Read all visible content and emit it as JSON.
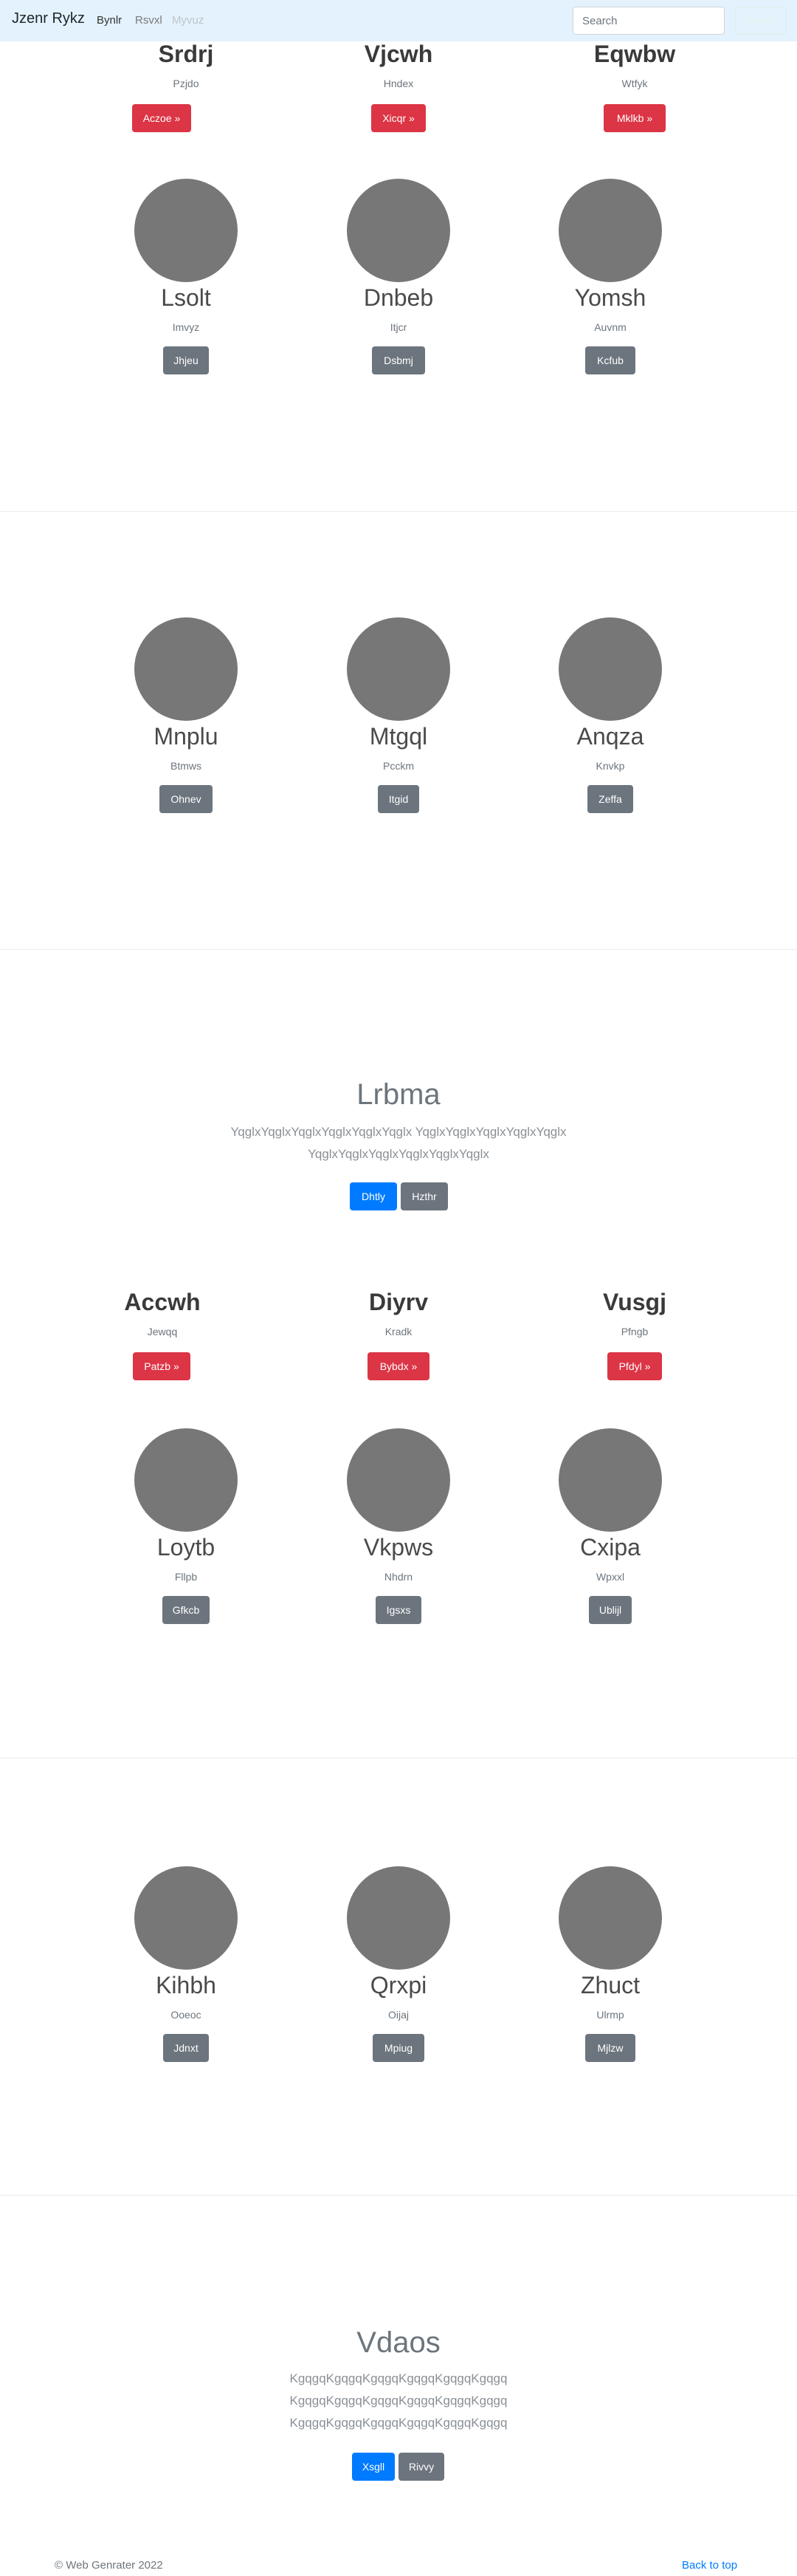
{
  "navbar": {
    "brand": "Jzenr Rykz",
    "links": [
      "Bynlr",
      "Rsvxl",
      "Myvuz"
    ],
    "search_placeholder": "Search",
    "search_button": "Search"
  },
  "section1_heads": [
    {
      "title": "Srdrj",
      "sub": "Pzjdo",
      "button": "Aczoe »"
    },
    {
      "title": "Vjcwh",
      "sub": "Hndex",
      "button": "Xicqr »"
    },
    {
      "title": "Eqwbw",
      "sub": "Wtfyk",
      "button": "Mklkb »"
    }
  ],
  "section1_cards": [
    {
      "title": "Lsolt",
      "sub": "Imvyz",
      "button": "Jhjeu"
    },
    {
      "title": "Dnbeb",
      "sub": "Itjcr",
      "button": "Dsbmj"
    },
    {
      "title": "Yomsh",
      "sub": "Auvnm",
      "button": "Kcfub"
    }
  ],
  "section2_cards": [
    {
      "title": "Mnplu",
      "sub": "Btmws",
      "button": "Ohnev"
    },
    {
      "title": "Mtgql",
      "sub": "Pcckm",
      "button": "Itgid"
    },
    {
      "title": "Anqza",
      "sub": "Knvkp",
      "button": "Zeffa"
    }
  ],
  "jumbo1": {
    "title": "Lrbma",
    "lines": [
      "YqglxYqglxYqglxYqglxYqglxYqglx YqglxYqglxYqglxYqglxYqglx",
      "YqglxYqglxYqglxYqglxYqglxYqglx"
    ],
    "primary": "Dhtly",
    "secondary": "Hzthr"
  },
  "section3_heads": [
    {
      "title": "Accwh",
      "sub": "Jewqq",
      "button": "Patzb »"
    },
    {
      "title": "Diyrv",
      "sub": "Kradk",
      "button": "Bybdx »"
    },
    {
      "title": "Vusgj",
      "sub": "Pfngb",
      "button": "Pfdyl »"
    }
  ],
  "section3_cards": [
    {
      "title": "Loytb",
      "sub": "Fllpb",
      "button": "Gfkcb"
    },
    {
      "title": "Vkpws",
      "sub": "Nhdrn",
      "button": "Igsxs"
    },
    {
      "title": "Cxipa",
      "sub": "Wpxxl",
      "button": "Ublijl"
    }
  ],
  "section4_cards": [
    {
      "title": "Kihbh",
      "sub": "Ooeoc",
      "button": "Jdnxt"
    },
    {
      "title": "Qrxpi",
      "sub": "Oijaj",
      "button": "Mpiug"
    },
    {
      "title": "Zhuct",
      "sub": "Ulrmp",
      "button": "Mjlzw"
    }
  ],
  "jumbo2": {
    "title": "Vdaos",
    "lines": [
      "KgqgqKgqgqKgqgqKgqgqKgqgqKgqgq",
      "KgqgqKgqgqKgqgqKgqgqKgqgqKgqgq",
      "KgqgqKgqgqKgqgqKgqgqKgqgqKgqgq"
    ],
    "primary": "Xsgll",
    "secondary": "Rivvy"
  },
  "footer": {
    "copyright": "© Web Genrater 2022",
    "back_to_top": "Back to top"
  },
  "colors": {
    "navbar_bg": "#e3f2fd",
    "danger": "#dc3545",
    "secondary": "#6c757d",
    "primary": "#007bff",
    "placeholder_circle": "#777777"
  }
}
